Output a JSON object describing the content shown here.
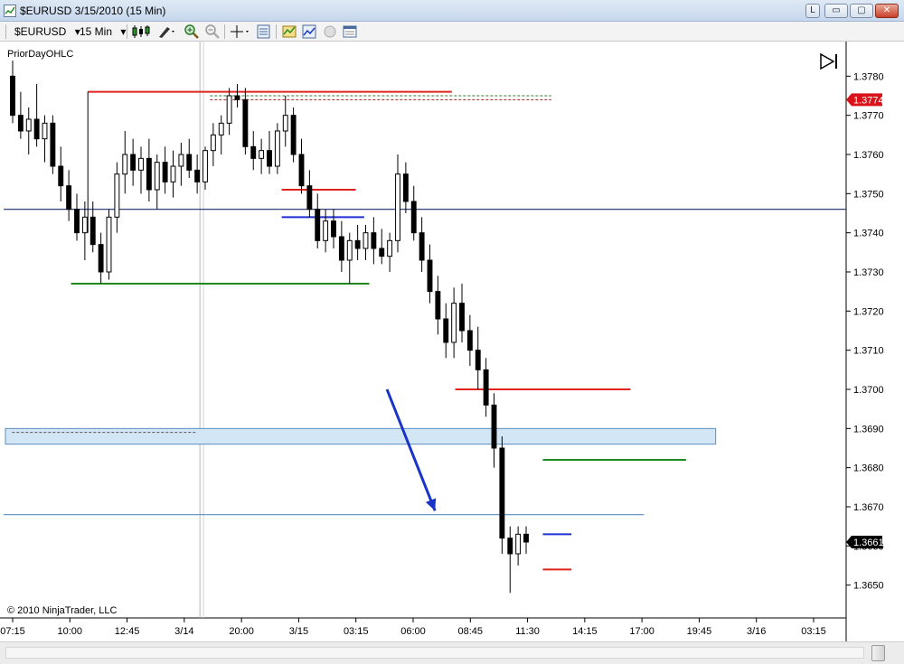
{
  "window": {
    "title": "$EURUSD  3/15/2010 (15 Min)",
    "buttons": {
      "link": "L",
      "minimize": "▭",
      "maximize": "▢",
      "close": "✕"
    }
  },
  "toolbar": {
    "instrument": "$EURUSD",
    "interval": "15 Min",
    "dropdown_glyph": "▾",
    "icons": [
      "candlestick-style-icon",
      "drawing-pen-icon",
      "zoom-in-icon",
      "zoom-out-icon",
      "crosshair-icon",
      "data-box-icon",
      "indicators-icon",
      "strategies-icon",
      "bar-type-icon",
      "properties-icon"
    ]
  },
  "chart": {
    "indicator_label": "PriorDayOHLC",
    "copyright": "© 2010 NinjaTrader, LLC",
    "colors": {
      "candle": "#000000",
      "prior_high": "#e0231c",
      "prior_low": "#1e8a1e",
      "prior_close": "#1f2fd6",
      "horizontal_line": "#1a2a6c",
      "support_line": "#5b8ec2",
      "zone_fill": "#d3e6f5",
      "zone_border": "#5b8ec2",
      "arrow": "#1a33c8",
      "price_marker_red": "#d8141a",
      "price_marker_dark": "#000000"
    }
  },
  "chart_data": {
    "type": "candlestick",
    "yaxis_ticks": [
      "1.3650",
      "1.3660",
      "1.3670",
      "1.3680",
      "1.3690",
      "1.3700",
      "1.3710",
      "1.3720",
      "1.3730",
      "1.3740",
      "1.3750",
      "1.3760",
      "1.3770",
      "1.3780"
    ],
    "ylim": [
      1.3643,
      1.3787
    ],
    "xaxis_ticks": [
      "07:15",
      "10:00",
      "12:45",
      "3/14",
      "20:00",
      "3/15",
      "03:15",
      "06:00",
      "08:45",
      "11:30",
      "14:15",
      "17:00",
      "19:45",
      "3/16",
      "03:15"
    ],
    "price_markers": [
      {
        "label": "1.3774",
        "value": 1.3774,
        "style": "red"
      },
      {
        "label": "1.3661",
        "value": 1.3661,
        "style": "dark"
      }
    ],
    "prior_day_lines": [
      {
        "kind": "high",
        "value": 1.3776,
        "x_start": 0.1,
        "x_end": 0.532
      },
      {
        "kind": "low",
        "value": 1.3727,
        "x_start": 0.08,
        "x_end": 0.434
      },
      {
        "kind": "open",
        "value": 1.3751,
        "x_start": 0.33,
        "x_end": 0.418
      },
      {
        "kind": "close",
        "value": 1.3744,
        "x_start": 0.33,
        "x_end": 0.428
      },
      {
        "kind": "open",
        "value": 1.37,
        "x_start": 0.536,
        "x_end": 0.744
      },
      {
        "kind": "low",
        "value": 1.3682,
        "x_start": 0.64,
        "x_end": 0.81
      },
      {
        "kind": "close",
        "value": 1.3663,
        "x_start": 0.64,
        "x_end": 0.674
      },
      {
        "kind": "high",
        "value": 1.3654,
        "x_start": 0.64,
        "x_end": 0.674
      }
    ],
    "dashed_lines": [
      {
        "value": 1.3775,
        "x_start": 0.245,
        "x_end": 0.65,
        "color": "#3a7a3a"
      },
      {
        "value": 1.3774,
        "x_start": 0.245,
        "x_end": 0.65,
        "color": "#a02020"
      },
      {
        "value": 1.3689,
        "x_start": 0.01,
        "x_end": 0.23,
        "color": "#555555"
      }
    ],
    "horizontal_lines": [
      {
        "value": 1.3746,
        "x_start": 0.0,
        "x_end": 1.0,
        "style": "horizontal_line"
      },
      {
        "value": 1.3668,
        "x_start": 0.0,
        "x_end": 0.76,
        "style": "support_line"
      }
    ],
    "zone": {
      "top": 1.369,
      "bottom": 1.3686,
      "x_start": 0.0,
      "x_end": 0.843
    },
    "arrow": {
      "from": [
        0.455,
        1.37
      ],
      "to": [
        0.512,
        1.3669
      ]
    },
    "session_marker_x": 0.233,
    "candles": [
      [
        1.378,
        1.3784,
        1.3768,
        1.377
      ],
      [
        1.377,
        1.3776,
        1.3764,
        1.3766
      ],
      [
        1.3766,
        1.3772,
        1.376,
        1.3769
      ],
      [
        1.3769,
        1.3778,
        1.3762,
        1.3764
      ],
      [
        1.3764,
        1.377,
        1.3758,
        1.3768
      ],
      [
        1.3768,
        1.377,
        1.3755,
        1.3757
      ],
      [
        1.3757,
        1.3762,
        1.3748,
        1.3752
      ],
      [
        1.3752,
        1.3756,
        1.3743,
        1.3746
      ],
      [
        1.3746,
        1.375,
        1.3738,
        1.374
      ],
      [
        1.374,
        1.3748,
        1.3733,
        1.3744
      ],
      [
        1.3744,
        1.3748,
        1.3735,
        1.3737
      ],
      [
        1.3737,
        1.374,
        1.3727,
        1.373
      ],
      [
        1.373,
        1.3746,
        1.3728,
        1.3744
      ],
      [
        1.3744,
        1.3758,
        1.374,
        1.3755
      ],
      [
        1.3755,
        1.3766,
        1.375,
        1.376
      ],
      [
        1.376,
        1.3764,
        1.3752,
        1.3756
      ],
      [
        1.3756,
        1.3762,
        1.375,
        1.3759
      ],
      [
        1.3759,
        1.3764,
        1.3748,
        1.3751
      ],
      [
        1.3751,
        1.376,
        1.3746,
        1.3758
      ],
      [
        1.3758,
        1.3762,
        1.375,
        1.3753
      ],
      [
        1.3753,
        1.3761,
        1.3749,
        1.3757
      ],
      [
        1.3757,
        1.3763,
        1.3752,
        1.376
      ],
      [
        1.376,
        1.3764,
        1.3754,
        1.3756
      ],
      [
        1.3756,
        1.376,
        1.375,
        1.3753
      ],
      [
        1.3753,
        1.3762,
        1.3751,
        1.3761
      ],
      [
        1.3761,
        1.3768,
        1.3757,
        1.3765
      ],
      [
        1.3765,
        1.377,
        1.376,
        1.3768
      ],
      [
        1.3768,
        1.3777,
        1.3765,
        1.3775
      ],
      [
        1.3775,
        1.3778,
        1.3772,
        1.3774
      ],
      [
        1.3774,
        1.3777,
        1.376,
        1.3762
      ],
      [
        1.3762,
        1.3766,
        1.3756,
        1.3759
      ],
      [
        1.3759,
        1.3764,
        1.3755,
        1.3761
      ],
      [
        1.3761,
        1.3766,
        1.3755,
        1.3757
      ],
      [
        1.3757,
        1.3768,
        1.3755,
        1.3766
      ],
      [
        1.3766,
        1.3775,
        1.3762,
        1.377
      ],
      [
        1.377,
        1.3772,
        1.3758,
        1.376
      ],
      [
        1.376,
        1.3764,
        1.375,
        1.3752
      ],
      [
        1.3752,
        1.3756,
        1.3744,
        1.3746
      ],
      [
        1.3746,
        1.375,
        1.3736,
        1.3738
      ],
      [
        1.3738,
        1.3746,
        1.3735,
        1.3743
      ],
      [
        1.3743,
        1.3746,
        1.3736,
        1.3739
      ],
      [
        1.3739,
        1.3743,
        1.373,
        1.3733
      ],
      [
        1.3733,
        1.374,
        1.3727,
        1.3738
      ],
      [
        1.3738,
        1.3742,
        1.3733,
        1.3736
      ],
      [
        1.3736,
        1.3742,
        1.3733,
        1.374
      ],
      [
        1.374,
        1.3744,
        1.3732,
        1.3736
      ],
      [
        1.3736,
        1.3741,
        1.3732,
        1.3734
      ],
      [
        1.3734,
        1.374,
        1.373,
        1.3738
      ],
      [
        1.3738,
        1.376,
        1.3735,
        1.3755
      ],
      [
        1.3755,
        1.3758,
        1.3745,
        1.3748
      ],
      [
        1.3748,
        1.3752,
        1.3738,
        1.374
      ],
      [
        1.374,
        1.3744,
        1.373,
        1.3733
      ],
      [
        1.3733,
        1.3737,
        1.3722,
        1.3725
      ],
      [
        1.3725,
        1.3729,
        1.3714,
        1.3718
      ],
      [
        1.3718,
        1.3722,
        1.3708,
        1.3712
      ],
      [
        1.3712,
        1.3726,
        1.3708,
        1.3722
      ],
      [
        1.3722,
        1.3727,
        1.3712,
        1.3715
      ],
      [
        1.3715,
        1.3719,
        1.3706,
        1.371
      ],
      [
        1.371,
        1.3716,
        1.37,
        1.3705
      ],
      [
        1.3705,
        1.3708,
        1.3693,
        1.3696
      ],
      [
        1.3696,
        1.3699,
        1.368,
        1.3685
      ],
      [
        1.3685,
        1.3688,
        1.3658,
        1.3662
      ],
      [
        1.3662,
        1.3665,
        1.3648,
        1.3658
      ],
      [
        1.3658,
        1.3665,
        1.3655,
        1.3663
      ],
      [
        1.3663,
        1.3665,
        1.3658,
        1.3661
      ]
    ]
  }
}
